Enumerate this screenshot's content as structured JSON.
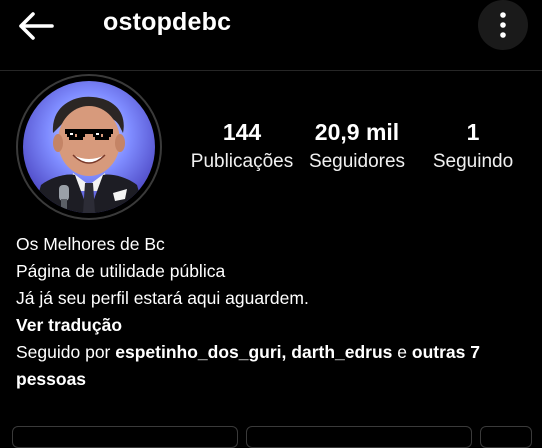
{
  "header": {
    "username": "ostopdebc",
    "back_icon": "arrow-left-icon",
    "menu_icon": "more-vertical-icon"
  },
  "profile": {
    "avatar": "profile-photo",
    "stats": [
      {
        "value": "144",
        "label": "Publicações"
      },
      {
        "value": "20,9 mil",
        "label": "Seguidores"
      },
      {
        "value": "1",
        "label": "Seguindo"
      }
    ]
  },
  "bio": {
    "name": "Os Melhores de Bc",
    "line1": "Página de utilidade pública",
    "line2": "Já já seu perfil estará aqui aguardem.",
    "translate": "Ver tradução",
    "followed_prefix": "Seguido por ",
    "follower1": "espetinho_dos_guri",
    "comma": ", ",
    "follower2": "darth_edrus",
    "and_text": " e ",
    "others": "outras 7 pessoas"
  },
  "colors": {
    "background": "#000000",
    "text": "#ffffff",
    "divider": "#262626"
  }
}
